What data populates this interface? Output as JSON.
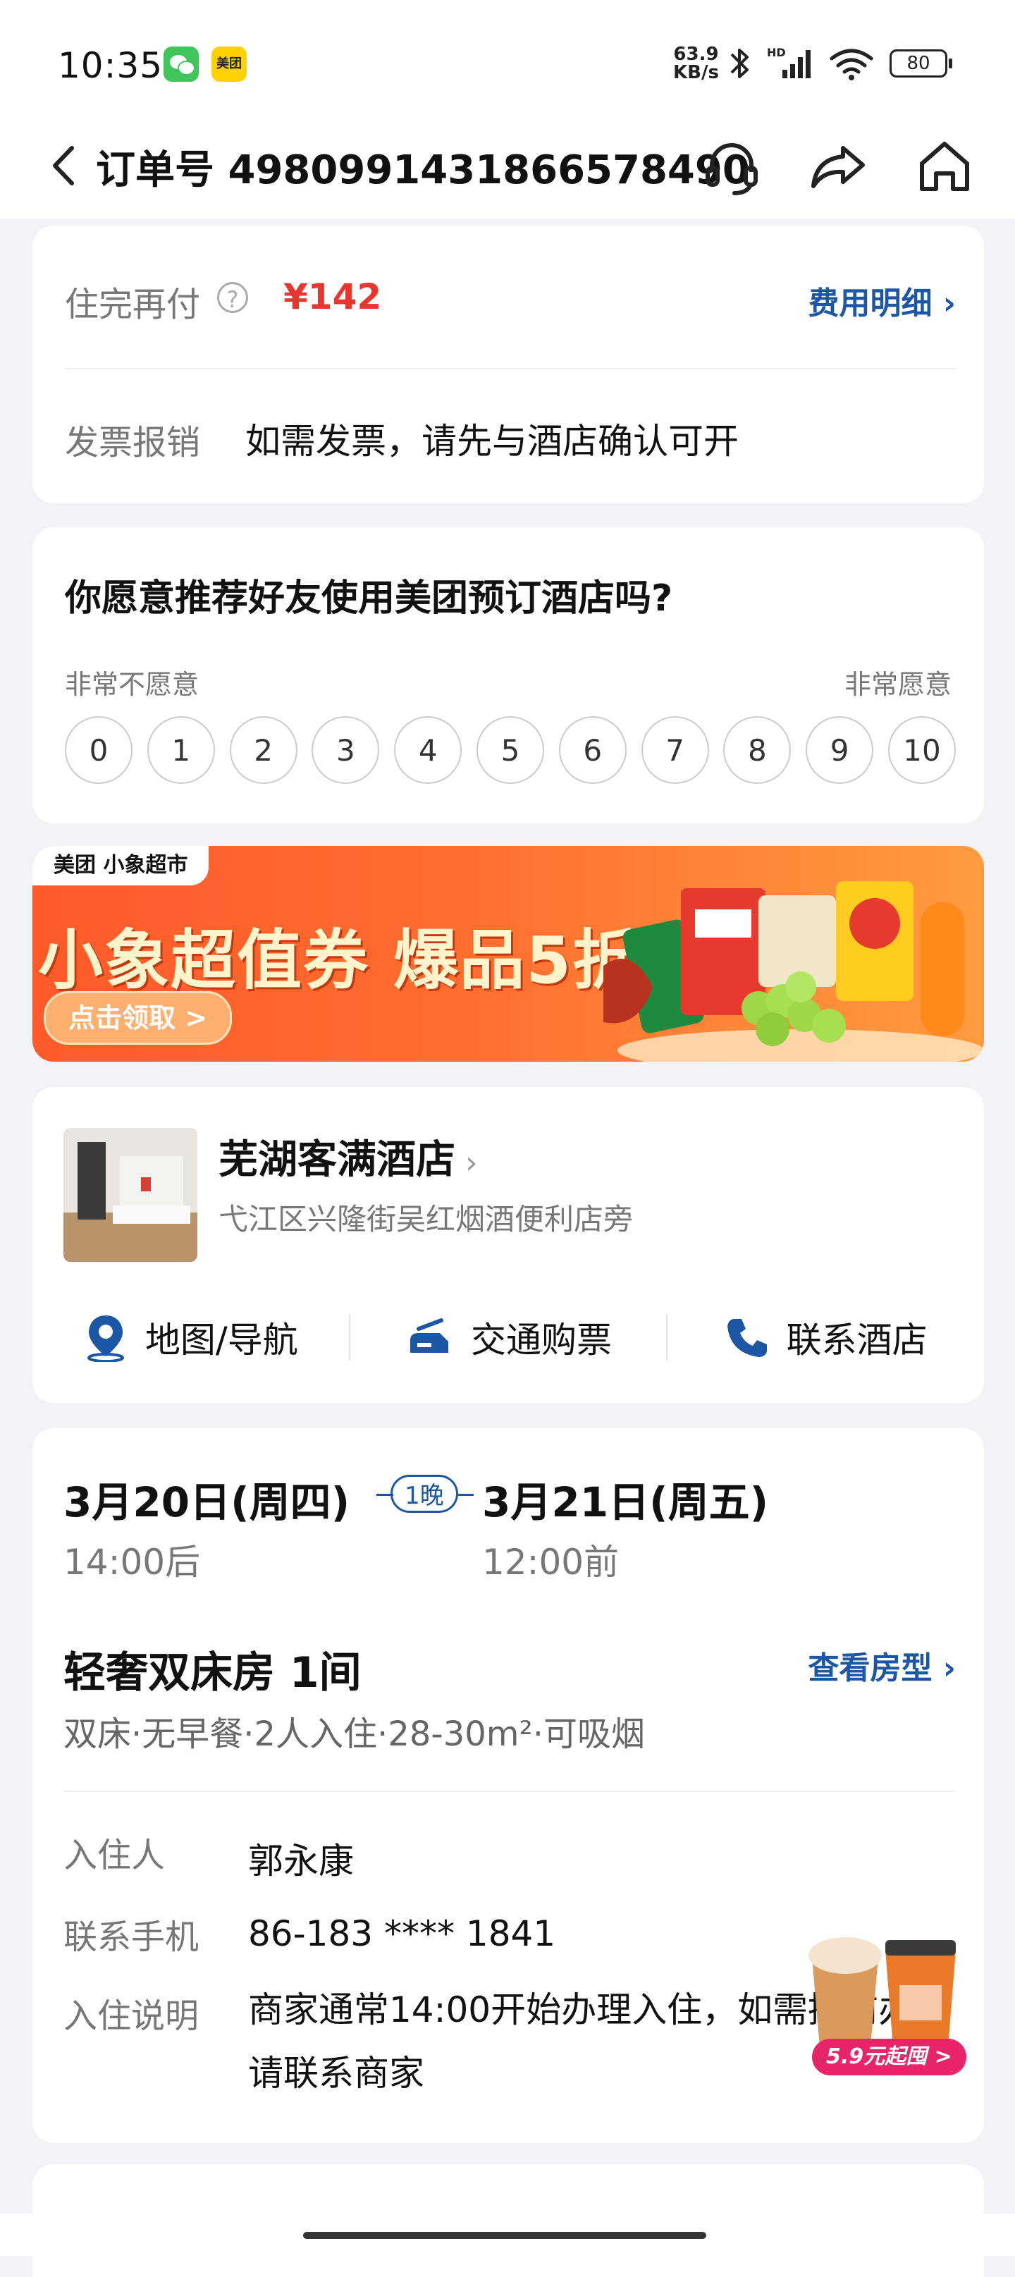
{
  "status_bar": {
    "time": "10:35",
    "app_icons": [
      "wechat-icon",
      "meituan-icon"
    ],
    "meituan_label": "美团",
    "net_speed_value": "63.9",
    "net_speed_unit": "KB/s",
    "network_label": "HD",
    "battery": "80"
  },
  "nav": {
    "title": "订单号 4980991431866578490",
    "icons": [
      "back-icon",
      "headset-icon",
      "share-icon",
      "home-icon"
    ]
  },
  "payment": {
    "label": "住完再付",
    "help_icon": "?",
    "amount": "¥142",
    "fee_link": "费用明细 ›",
    "invoice_label": "发票报销",
    "invoice_text": "如需发票，请先与酒店确认可开"
  },
  "recommend": {
    "question": "你愿意推荐好友使用美团预订酒店吗?",
    "low_label": "非常不愿意",
    "high_label": "非常愿意",
    "scores": [
      "0",
      "1",
      "2",
      "3",
      "4",
      "5",
      "6",
      "7",
      "8",
      "9",
      "10"
    ]
  },
  "banner": {
    "tag": "美团  小象超市",
    "title": "小象超值券 爆品5折起",
    "button": "点击领取 >"
  },
  "hotel": {
    "name": "芜湖客满酒店",
    "address": "弋江区兴隆街吴红烟酒便利店旁",
    "actions": [
      {
        "label": "地图/导航",
        "icon": "map-pin-icon"
      },
      {
        "label": "交通购票",
        "icon": "transport-ticket-icon"
      },
      {
        "label": "联系酒店",
        "icon": "phone-icon"
      }
    ]
  },
  "booking": {
    "checkin_date": "3月20日(周四)",
    "checkin_time": "14:00后",
    "nights": "1晚",
    "checkout_date": "3月21日(周五)",
    "checkout_time": "12:00前",
    "room_name": "轻奢双床房 1间",
    "room_link": "查看房型 ›",
    "room_desc": "双床·无早餐·2人入住·28-30m²·可吸烟",
    "guest_label": "入住人",
    "guest_value": "郭永康",
    "phone_label": "联系手机",
    "phone_value": "86-183 **** 1841",
    "note_label": "入住说明",
    "note_value": "商家通常14:00开始办理入住，如需提前办理请联系商家",
    "promo_badge": "5.9元起囤 >"
  },
  "colors": {
    "price_red": "#e8352e",
    "link_blue": "#1c57a5",
    "banner_orange": "#ff5a2a",
    "page_bg": "#f2f3f7"
  }
}
